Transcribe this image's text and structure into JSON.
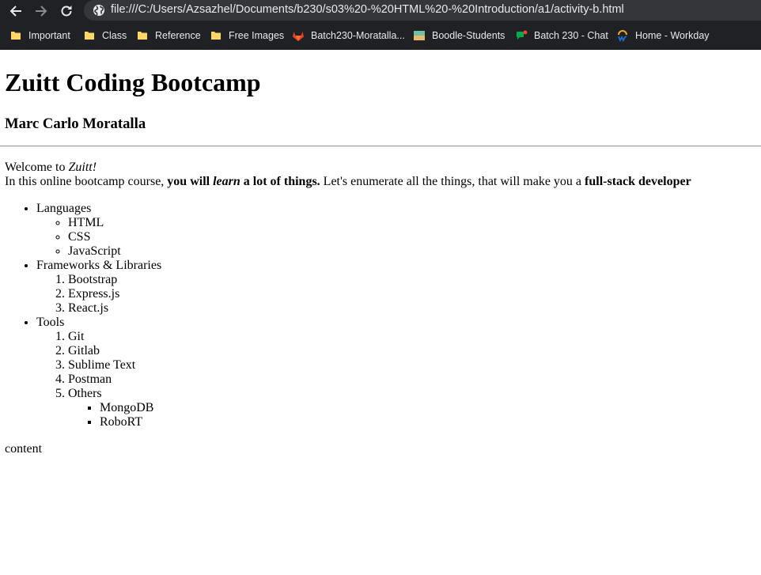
{
  "browser": {
    "url": "file:///C:/Users/Azsazhel/Documents/b230/s03%20-%20HTML%20-%20Introduction/a1/activity-b.html",
    "bookmarks": [
      {
        "label": "Important",
        "icon": "folder-icon"
      },
      {
        "label": "Class",
        "icon": "folder-icon"
      },
      {
        "label": "Reference",
        "icon": "folder-icon"
      },
      {
        "label": "Free Images",
        "icon": "folder-icon"
      },
      {
        "label": "Batch230-Moratalla...",
        "icon": "gitlab-icon"
      },
      {
        "label": "Boodle-Students",
        "icon": "boodle-icon"
      },
      {
        "label": "Batch 230 - Chat",
        "icon": "chat-icon"
      },
      {
        "label": "Home - Workday",
        "icon": "workday-icon"
      }
    ]
  },
  "page": {
    "title": "Zuitt Coding Bootcamp",
    "author": "Marc Carlo Moratalla",
    "welcome_prefix": "Welcome to ",
    "welcome_brand": "Zuitt!",
    "intro_1": "In this online bootcamp course, ",
    "intro_bold_1": "you will ",
    "intro_bold_italic": "learn",
    "intro_bold_2": " a lot of things.",
    "intro_2": " Let's enumerate all the things, that will make you a ",
    "intro_bold_3": "full-stack developer",
    "languages": {
      "label": "Languages",
      "items": [
        "HTML",
        "CSS",
        "JavaScript"
      ]
    },
    "frameworks": {
      "label": "Frameworks & Libraries",
      "items": [
        "Bootstrap",
        "Express.js",
        "React.js"
      ]
    },
    "tools": {
      "label": "Tools",
      "items": [
        "Git",
        "Gitlab",
        "Sublime Text",
        "Postman"
      ],
      "others": {
        "label": "Others",
        "items": [
          "MongoDB",
          "RoboRT"
        ]
      }
    },
    "footer_text": "content"
  },
  "colors": {
    "chrome_bg": "#202124",
    "omnibox_bg": "#35363a",
    "chrome_text": "#e8eaed",
    "folder": "#fdd663"
  }
}
